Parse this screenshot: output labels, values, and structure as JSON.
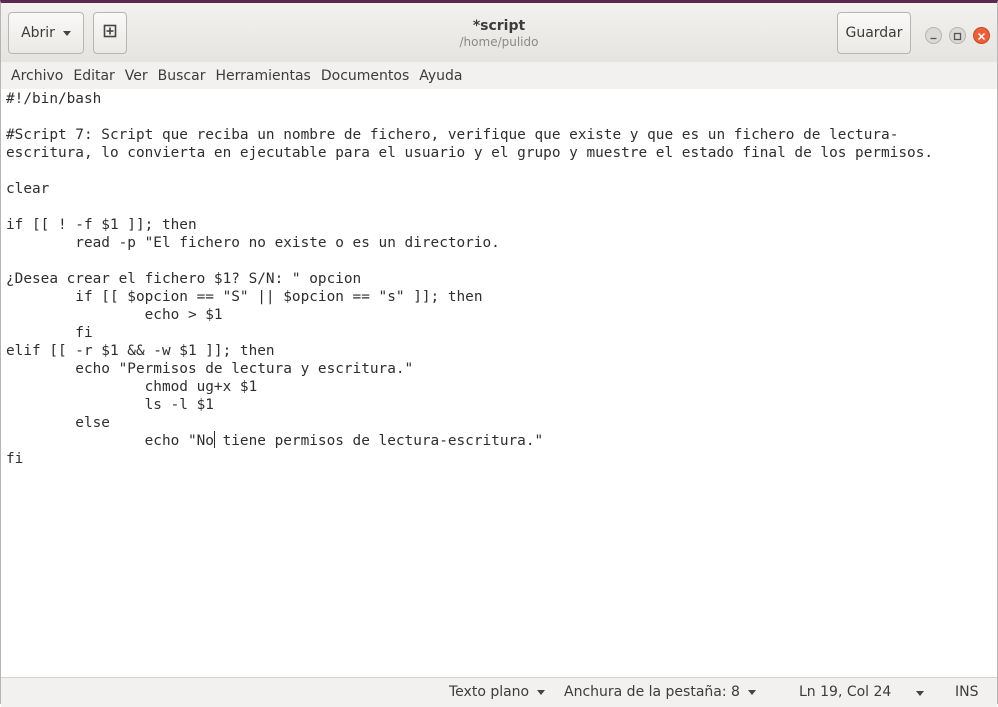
{
  "header": {
    "open_label": "Abrir",
    "save_label": "Guardar",
    "title": "*script",
    "subtitle": "/home/pulido"
  },
  "menu": [
    "Archivo",
    "Editar",
    "Ver",
    "Buscar",
    "Herramientas",
    "Documentos",
    "Ayuda"
  ],
  "editor": {
    "lines": [
      "#!/bin/bash",
      "",
      "#Script 7: Script que reciba un nombre de fichero, verifique que existe y que es un fichero de lectura-",
      "escritura, lo convierta en ejecutable para el usuario y el grupo y muestre el estado final de los permisos.",
      "",
      "clear",
      "",
      "if [[ ! -f $1 ]]; then",
      "        read -p \"El fichero no existe o es un directorio.",
      "",
      "¿Desea crear el fichero $1? S/N: \" opcion",
      "        if [[ $opcion == \"S\" || $opcion == \"s\" ]]; then",
      "                echo > $1",
      "        fi",
      "elif [[ -r $1 && -w $1 ]]; then",
      "        echo \"Permisos de lectura y escritura.\"",
      "                chmod ug+x $1",
      "                ls -l $1",
      "        else",
      "                echo \"No tiene permisos de lectura-escritura.\"",
      "fi"
    ]
  },
  "status": {
    "language": "Texto plano",
    "tab_width": "Anchura de la pestaña: 8",
    "position": "Ln 19, Col 24",
    "mode": "INS"
  },
  "icons": {
    "new_tab": "new-document-icon",
    "minimize": "minimize-icon",
    "maximize": "maximize-icon",
    "close": "close-icon"
  },
  "colors": {
    "close_button": "#e9603a",
    "title_accent": "#5e2750"
  }
}
